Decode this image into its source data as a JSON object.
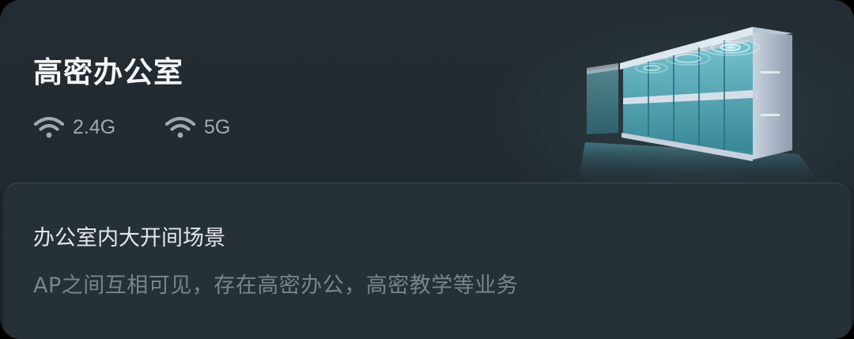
{
  "card": {
    "title": "高密办公室",
    "bands": [
      {
        "label": "2.4G",
        "icon": "wifi-icon"
      },
      {
        "label": "5G",
        "icon": "wifi-icon"
      }
    ],
    "illustration_icon": "office-building-illustration"
  },
  "scene": {
    "title": "办公室内大开间场景",
    "description": "AP之间互相可见，存在高密办公，高密教学等业务"
  },
  "colors": {
    "card_background": "#222b31",
    "panel_background": "#263037",
    "title_text": "#f2f4f5",
    "secondary_text": "#a1a9ae",
    "description_text": "#79848b",
    "glass_accent": "#6fd6e6"
  }
}
